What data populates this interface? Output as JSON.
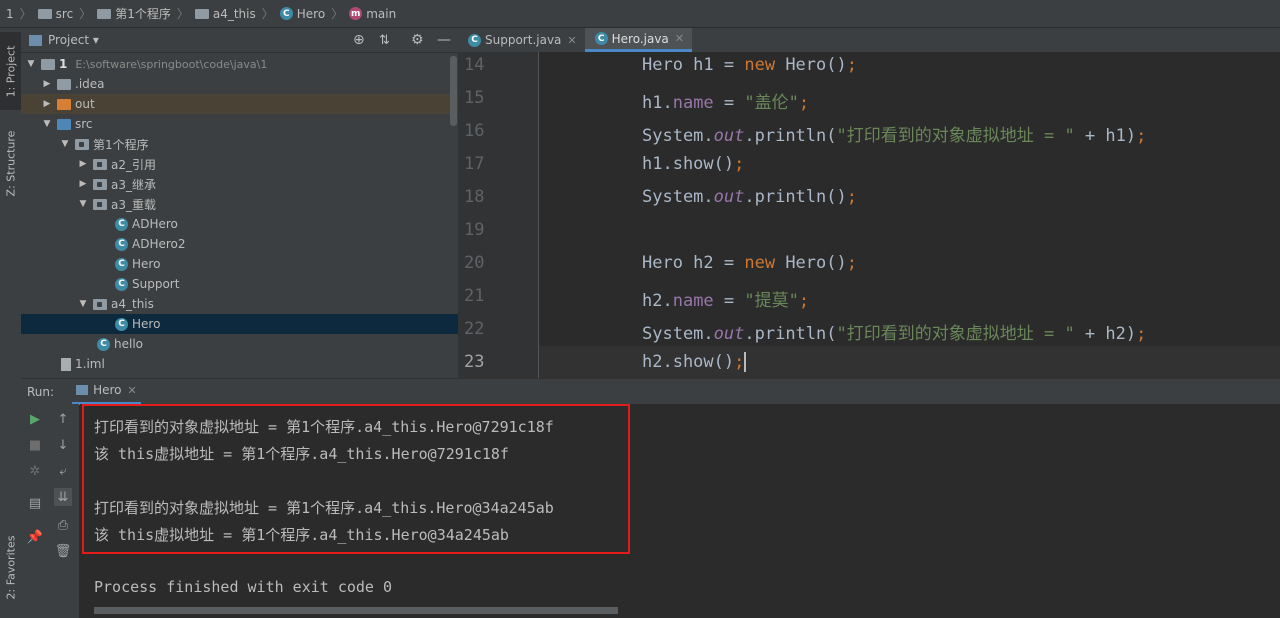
{
  "breadcrumb": [
    {
      "label": "1",
      "icon": "none"
    },
    {
      "label": "src",
      "icon": "folder-icon"
    },
    {
      "label": "第1个程序",
      "icon": "folder-icon"
    },
    {
      "label": "a4_this",
      "icon": "folder-icon"
    },
    {
      "label": "Hero",
      "icon": "class-icon"
    },
    {
      "label": "main",
      "icon": "method-icon"
    }
  ],
  "left_strip": {
    "project_tab": "1: Project",
    "structure_tab": "Z: Structure",
    "favorites_tab": "2: Favorites"
  },
  "project": {
    "title": "Project",
    "tree": [
      {
        "label": "1",
        "path": "E:\\software\\springboot\\code\\java\\1",
        "kind": "root",
        "expanded": true
      },
      {
        "label": ".idea",
        "kind": "folder",
        "expanded": false
      },
      {
        "label": "out",
        "kind": "folder-orange",
        "expanded": false
      },
      {
        "label": "src",
        "kind": "folder",
        "expanded": true
      },
      {
        "label": "第1个程序",
        "kind": "package",
        "expanded": true
      },
      {
        "label": "a2_引用",
        "kind": "package",
        "expanded": false
      },
      {
        "label": "a3_继承",
        "kind": "package",
        "expanded": false
      },
      {
        "label": "a3_重载",
        "kind": "package",
        "expanded": true
      },
      {
        "label": "ADHero",
        "kind": "class"
      },
      {
        "label": "ADHero2",
        "kind": "class"
      },
      {
        "label": "Hero",
        "kind": "class"
      },
      {
        "label": "Support",
        "kind": "class"
      },
      {
        "label": "a4_this",
        "kind": "package",
        "expanded": true
      },
      {
        "label": "Hero",
        "kind": "class",
        "selected": true
      },
      {
        "label": "hello",
        "kind": "class"
      },
      {
        "label": "1.iml",
        "kind": "file"
      }
    ]
  },
  "editor": {
    "tabs": [
      {
        "label": "Support.java",
        "active": false
      },
      {
        "label": "Hero.java",
        "active": true
      }
    ],
    "line_numbers": [
      "14",
      "15",
      "16",
      "17",
      "18",
      "19",
      "20",
      "21",
      "22",
      "23"
    ]
  },
  "run": {
    "label": "Run:",
    "tab": "Hero",
    "output": [
      "打印看到的对象虚拟地址 = 第1个程序.a4_this.Hero@7291c18f",
      "该 this虚拟地址 = 第1个程序.a4_this.Hero@7291c18f",
      "",
      "打印看到的对象虚拟地址 = 第1个程序.a4_this.Hero@34a245ab",
      "该 this虚拟地址 = 第1个程序.a4_this.Hero@34a245ab",
      "",
      "Process finished with exit code 0"
    ]
  },
  "colors": {
    "highlight_box": "#e31b1b",
    "selection": "#0d293e",
    "keyword": "#cc7832",
    "string": "#6a8759",
    "field": "#9876aa"
  }
}
